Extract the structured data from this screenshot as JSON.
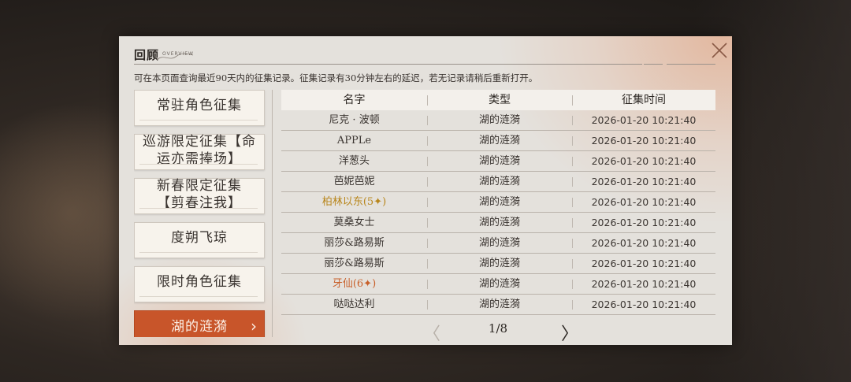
{
  "dialog": {
    "title": "回顾",
    "subtitle": "OVERVIEW",
    "notice": "可在本页面查询最近90天内的征集记录。征集记录有30分钟左右的延迟，若无记录请稍后重新打开。",
    "close_icon": "close-icon"
  },
  "sidebar": {
    "items": [
      {
        "label": "常驻角色征集",
        "active": false
      },
      {
        "label": "巡游限定征集【命运亦需捧场】",
        "active": false
      },
      {
        "label": "新春限定征集【剪春注我】",
        "active": false
      },
      {
        "label": "度朔飞琼",
        "active": false
      },
      {
        "label": "限时角色征集",
        "active": false
      },
      {
        "label": "湖的涟漪",
        "active": true
      }
    ],
    "active_color": "#c8552a"
  },
  "table": {
    "headers": [
      "名字",
      "类型",
      "征集时间"
    ],
    "rows": [
      {
        "name": "尼克 · 波顿",
        "type": "湖的涟漪",
        "time": "2026-01-20 10:21:40",
        "rarity": ""
      },
      {
        "name": "APPLe",
        "type": "湖的涟漪",
        "time": "2026-01-20 10:21:40",
        "rarity": ""
      },
      {
        "name": "洋葱头",
        "type": "湖的涟漪",
        "time": "2026-01-20 10:21:40",
        "rarity": ""
      },
      {
        "name": "芭妮芭妮",
        "type": "湖的涟漪",
        "time": "2026-01-20 10:21:40",
        "rarity": ""
      },
      {
        "name": "柏林以东(5✦)",
        "type": "湖的涟漪",
        "time": "2026-01-20 10:21:40",
        "rarity": "5"
      },
      {
        "name": "莫桑女士",
        "type": "湖的涟漪",
        "time": "2026-01-20 10:21:40",
        "rarity": ""
      },
      {
        "name": "丽莎&路易斯",
        "type": "湖的涟漪",
        "time": "2026-01-20 10:21:40",
        "rarity": ""
      },
      {
        "name": "丽莎&路易斯",
        "type": "湖的涟漪",
        "time": "2026-01-20 10:21:40",
        "rarity": ""
      },
      {
        "name": "牙仙(6✦)",
        "type": "湖的涟漪",
        "time": "2026-01-20 10:21:40",
        "rarity": "6"
      },
      {
        "name": "哒哒达利",
        "type": "湖的涟漪",
        "time": "2026-01-20 10:21:40",
        "rarity": ""
      }
    ],
    "rarity_colors": {
      "5": "#b8861c",
      "6": "#c8602a"
    }
  },
  "pagination": {
    "text": "1/8",
    "prev_icon": "chevron-left-icon",
    "next_icon": "chevron-right-icon",
    "prev_enabled": false
  }
}
